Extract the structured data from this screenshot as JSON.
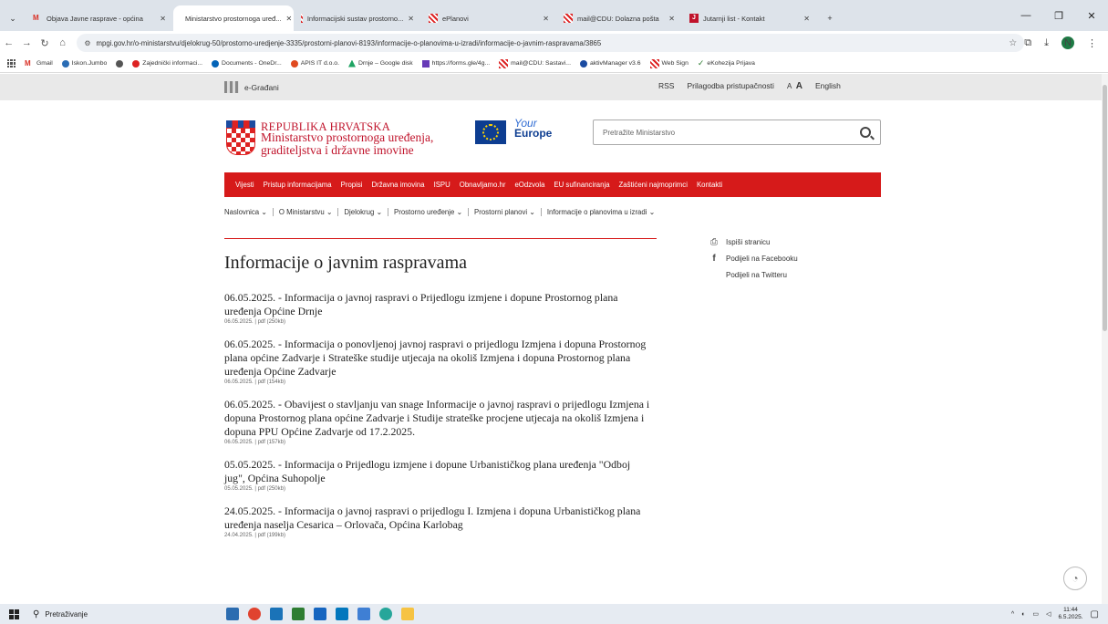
{
  "browser": {
    "tabs": [
      {
        "title": "Objava Javne rasprave - općina",
        "icon": "gmail-icon",
        "active": false
      },
      {
        "title": "Ministarstvo prostornoga uređ...",
        "icon": "ministry-icon",
        "active": true
      },
      {
        "title": "Informacijski sustav prostorno...",
        "icon": "ministry-icon",
        "active": false
      },
      {
        "title": "ePlanovi",
        "icon": "ministry-icon",
        "active": false
      },
      {
        "title": "mail@CDU: Dolazna pošta",
        "icon": "ministry-icon",
        "active": false
      },
      {
        "title": "Jutarnji list - Kontakt",
        "icon": "jutarnji-icon",
        "active": false
      }
    ],
    "new_tab": "+",
    "url": "mpgi.gov.hr/o-ministarstvu/djelokrug-50/prostorno-uredjenje-3335/prostorni-planovi-8193/informacije-o-planovima-u-izradi/informacije-o-javnim-raspravama/3865",
    "profile_initial": "N",
    "bookmarks": [
      {
        "label": "Gmail",
        "color": "#d93025"
      },
      {
        "label": "Iskon.Jumbo",
        "color": "#2a6db5"
      },
      {
        "label": "",
        "color": "#555555"
      },
      {
        "label": "Zajednički informaci...",
        "color": "#d22222"
      },
      {
        "label": "Documents - OneDr...",
        "color": "#0364b8"
      },
      {
        "label": "APIS IT d.o.o.",
        "color": "#e04a1f"
      },
      {
        "label": "Drnje – Google disk",
        "color": "#1fa463"
      },
      {
        "label": "https://forms.gle/4g...",
        "color": "#673ab7"
      },
      {
        "label": "mail@CDU: Sastavi...",
        "color": "#d22222"
      },
      {
        "label": "aktivManager v3.6",
        "color": "#1b4ba1"
      },
      {
        "label": "Web Sign",
        "color": "#d22222"
      },
      {
        "label": "eKohezija Prijava",
        "color": "#2e7d32"
      }
    ]
  },
  "site": {
    "egradjani": "e-Građani",
    "top_links": {
      "rss": "RSS",
      "accessibility": "Prilagodba pristupačnosti",
      "font_small": "A",
      "font_big": "A",
      "english": "English"
    },
    "header": {
      "country": "REPUBLIKA HRVATSKA",
      "ministry": "Ministarstvo prostornoga uređenja, graditeljstva i državne imovine",
      "your": "Your",
      "europe": "Europe",
      "search_placeholder": "Pretražite Ministarstvo"
    },
    "nav": [
      "Vijesti",
      "Pristup informacijama",
      "Propisi",
      "Državna imovina",
      "ISPU",
      "Obnavljamo.hr",
      "eOdzvola",
      "EU sufinanciranja",
      "Zaštićeni najmoprimci",
      "Kontakti"
    ],
    "breadcrumbs": [
      "Naslovnica ⌄",
      "O Ministarstvu ⌄",
      "Djelokrug ⌄",
      "Prostorno uređenje ⌄",
      "Prostorni planovi ⌄",
      "Informacije o planovima u izradi ⌄"
    ],
    "page_title": "Informacije o javnim raspravama",
    "side": {
      "print": "Ispiši stranicu",
      "facebook": "Podijeli na Facebooku",
      "twitter": "Podijeli na Twitteru"
    },
    "items": [
      {
        "title": "06.05.2025. - Informacija o javnoj raspravi o Prijedlogu izmjene i dopune Prostornog plana uređenja Općine Drnje",
        "meta": "06.05.2025. | pdf (250kb)"
      },
      {
        "title": "06.05.2025. - Informacija o ponovljenoj javnoj raspravi o prijedlogu Izmjena i dopuna Prostornog plana općine Zadvarje i Strateške studije utjecaja na okoliš Izmjena i dopuna Prostornog plana uređenja Općine Zadvarje",
        "meta": "06.05.2025. | pdf (154kb)"
      },
      {
        "title": "06.05.2025. - Obavijest o stavljanju van snage Informacije o javnoj raspravi o prijedlogu Izmjena i dopuna Prostornog plana općine Zadvarje i Studije strateške procjene utjecaja na okoliš Izmjena i dopuna PPU Općine Zadvarje od 17.2.2025.",
        "meta": "06.05.2025. | pdf (157kb)"
      },
      {
        "title": "05.05.2025. - Informacija o Prijedlogu izmjene i dopune Urbanističkog plana uređenja \"Odboj jug\", Općina Suhopolje",
        "meta": "05.05.2025. | pdf (250kb)"
      },
      {
        "title": "24.05.2025. - Informacija o javnoj raspravi o prijedlogu I. Izmjena i dopuna Urbanističkog plana uređenja naselja Cesarica – Orlovača, Općina Karlobag",
        "meta": "24.04.2025. | pdf (199kb)"
      }
    ]
  },
  "taskbar": {
    "search_placeholder": "Pretraživanje",
    "time": "11:44",
    "date": "6.5.2025."
  },
  "colors": {
    "accent_red": "#d61a1a",
    "ministry_red": "#c0132b",
    "eu_blue": "#0d3d91"
  }
}
